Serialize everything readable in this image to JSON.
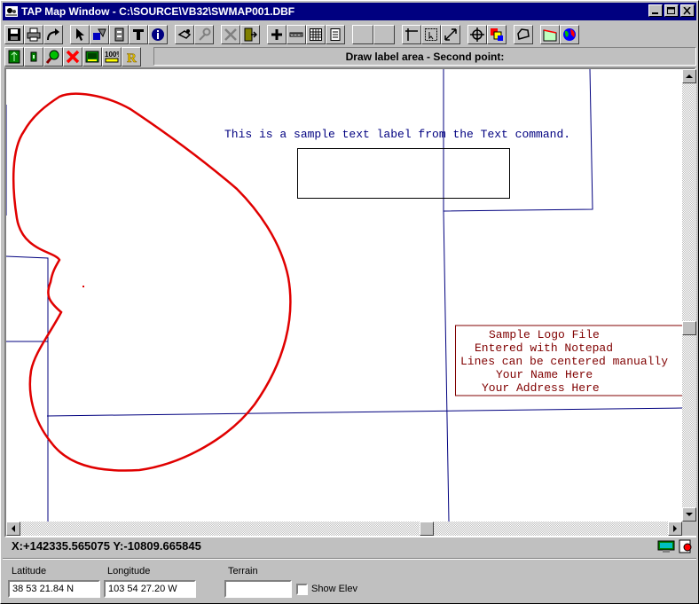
{
  "window": {
    "title": "TAP Map Window - C:\\SOURCE\\VB32\\SWMAP001.DBF"
  },
  "toolbar": {
    "row1_icons": [
      "save-icon",
      "print-icon",
      "redo-arrow-icon",
      "pointer-icon",
      "shapes-icon",
      "file-cabinet-icon",
      "text-tool-icon",
      "info-icon",
      "draw-tool-icon",
      "pin-tool-icon",
      "delete-x-icon",
      "exit-door-icon",
      "add-point-icon",
      "ruler-icon",
      "grid-icon",
      "notepad-icon",
      "blank-button-1",
      "blank-button-2",
      "snap-icon",
      "region-select-icon",
      "resize-icon",
      "crosshair-icon",
      "layers-icon",
      "polygon-icon",
      "area-fill-icon",
      "globe-icon"
    ],
    "row2_icons": [
      "layer-green-icon",
      "layer-small-icon",
      "zoom-icon",
      "cancel-red-x-icon",
      "screen-icon",
      "zoom-100-icon",
      "redraw-r-icon"
    ]
  },
  "prompt": "Draw label area - Second point:",
  "map": {
    "sample_text": "This is a sample text label from the Text command.",
    "logo_lines": [
      "Sample Logo File",
      "Entered with Notepad",
      "Lines can be centered manually",
      "Your Name Here",
      "Your Address Here"
    ],
    "colors": {
      "boundary": "#00007f",
      "region_outline": "#e00000",
      "logo_text": "#800000",
      "label_text": "#000080"
    }
  },
  "status": {
    "coordinates": "X:+142335.565075 Y:-10809.665845"
  },
  "position": {
    "latitude_label": "Latitude",
    "latitude_value": "38 53 21.84 N",
    "longitude_label": "Longitude",
    "longitude_value": "103 54 27.20 W",
    "terrain_label": "Terrain",
    "terrain_value": "",
    "show_elev_label": "Show Elev"
  }
}
